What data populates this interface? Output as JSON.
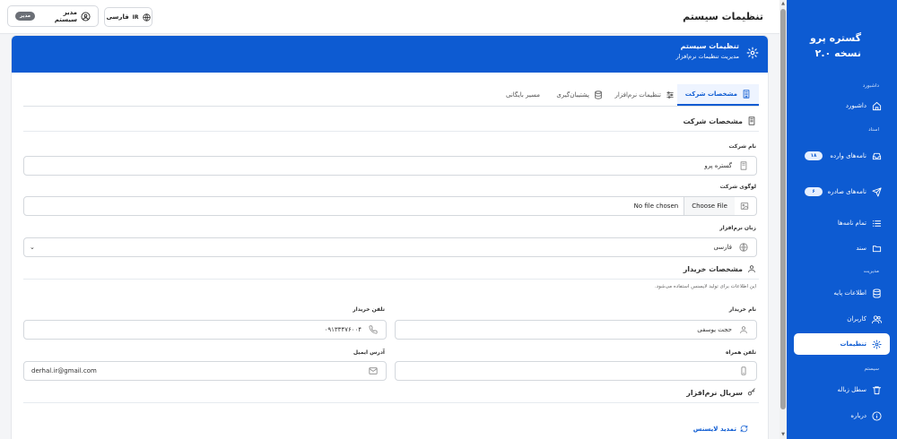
{
  "sidebar": {
    "brand_name": "گستره پرو",
    "brand_version": "نسخه ۲.۰",
    "sections": {
      "dashboard": "داشبورد",
      "docs": "اسناد",
      "manage": "مدیریت",
      "system": "سیستم"
    },
    "items": [
      {
        "label": "داشبورد",
        "icon": "home-icon"
      },
      {
        "label": "نامه‌های وارده",
        "icon": "inbox-icon",
        "badge": "۱۸"
      },
      {
        "label": "نامه‌های صادره",
        "icon": "send-icon",
        "badge": "۶"
      },
      {
        "label": "تمام نامه‌ها",
        "icon": "list-icon"
      },
      {
        "label": "سند",
        "icon": "folder-icon"
      },
      {
        "label": "اطلاعات پایه",
        "icon": "database-icon"
      },
      {
        "label": "کاربران",
        "icon": "users-icon"
      },
      {
        "label": "تنظیمات",
        "icon": "gear-icon",
        "active": true
      },
      {
        "label": "سطل زباله",
        "icon": "trash-icon"
      },
      {
        "label": "درباره",
        "icon": "info-icon"
      }
    ],
    "color": "#0d5bd2"
  },
  "header": {
    "title": "تنظیمات سیستم",
    "user_label": "مدیر سیستم",
    "role_badge": "مدیر",
    "lang_label": "فارسی",
    "lang_code": "IR"
  },
  "card": {
    "title": "تنظیمات سیستم",
    "subtitle": "مدیریت تنظیمات نرم‌افزار"
  },
  "tabs": [
    {
      "label": "مشخصات شرکت",
      "icon": "building-icon",
      "active": true
    },
    {
      "label": "تنظیمات نرم‌افزار",
      "icon": "sliders-icon"
    },
    {
      "label": "پشتیبان‌گیری",
      "icon": "database-icon"
    },
    {
      "label": "مسیر بایگانی",
      "icon": ""
    }
  ],
  "company": {
    "section_title": "مشخصات شرکت",
    "name_label": "نام شرکت",
    "name_value": "گستره پرو",
    "logo_label": "لوگوی شرکت",
    "choose_file": "Choose File",
    "no_file": "No file chosen",
    "lang_label": "زبان نرم‌افزار",
    "lang_value": "فارسی"
  },
  "buyer": {
    "section_title": "مشخصات خریدار",
    "hint": "این اطلاعات برای تولید لایسنس استفاده می‌شود.",
    "name_label": "نام خریدار",
    "name_value": "حجت یوسفی",
    "phone_label": "تلفن خریدار",
    "phone_value": "۰۹۱۳۳۴۷۶۰۰۴",
    "mobile_label": "تلفن همراه",
    "mobile_value": "",
    "email_label": "آدرس ایمیل",
    "email_value": "derhal.ir@gmail.com"
  },
  "serial": {
    "section_title": "سریال نرم‌افزار",
    "renew_label": "تمدید لایسنس"
  }
}
